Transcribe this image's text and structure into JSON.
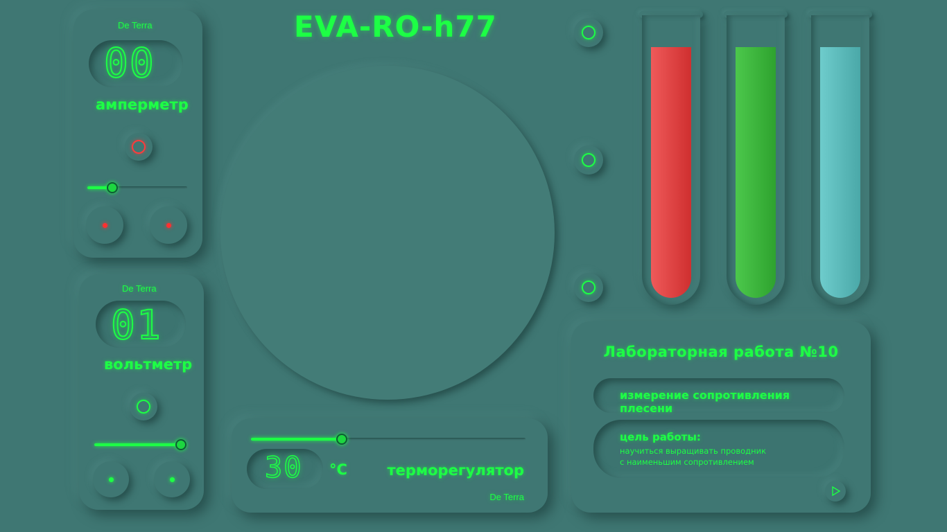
{
  "app_title": "EVA-RO-h77",
  "ammeter": {
    "brand": "De Terra",
    "reading": "00",
    "label": "амперметр",
    "slider_level_percent": 25,
    "colors": {
      "indicator": "#ff3b3b"
    }
  },
  "voltmeter": {
    "brand": "De Terra",
    "reading": "01",
    "label": "вольтметр",
    "slider_level_percent": 95,
    "colors": {
      "indicator": "#1dff45"
    }
  },
  "thermo": {
    "reading": "30",
    "unit": "°C",
    "label": "терморегулятор",
    "brand": "De Terra",
    "slider_level_percent": 33
  },
  "tubes": [
    {
      "color_top": "#ef5a5a",
      "color_bottom": "#cf2f2f",
      "fill_level_percent": 87
    },
    {
      "color_top": "#4cc84c",
      "color_bottom": "#2ea22e",
      "fill_level_percent": 87
    },
    {
      "color_top": "#6ecccc",
      "color_bottom": "#4aa8a8",
      "fill_level_percent": 87
    }
  ],
  "lab": {
    "title": "Лабораторная работа №10",
    "subject": "измерение сопротивления плесени",
    "goal_heading": "цель работы:",
    "goal_line1": "научиться выращивать проводник",
    "goal_line2": "с наименьшим сопротивлением",
    "next_icon": "play-triangle-icon"
  },
  "colors": {
    "background": "#3f7773",
    "accent": "#1dff45",
    "alert": "#ff3b3b"
  }
}
